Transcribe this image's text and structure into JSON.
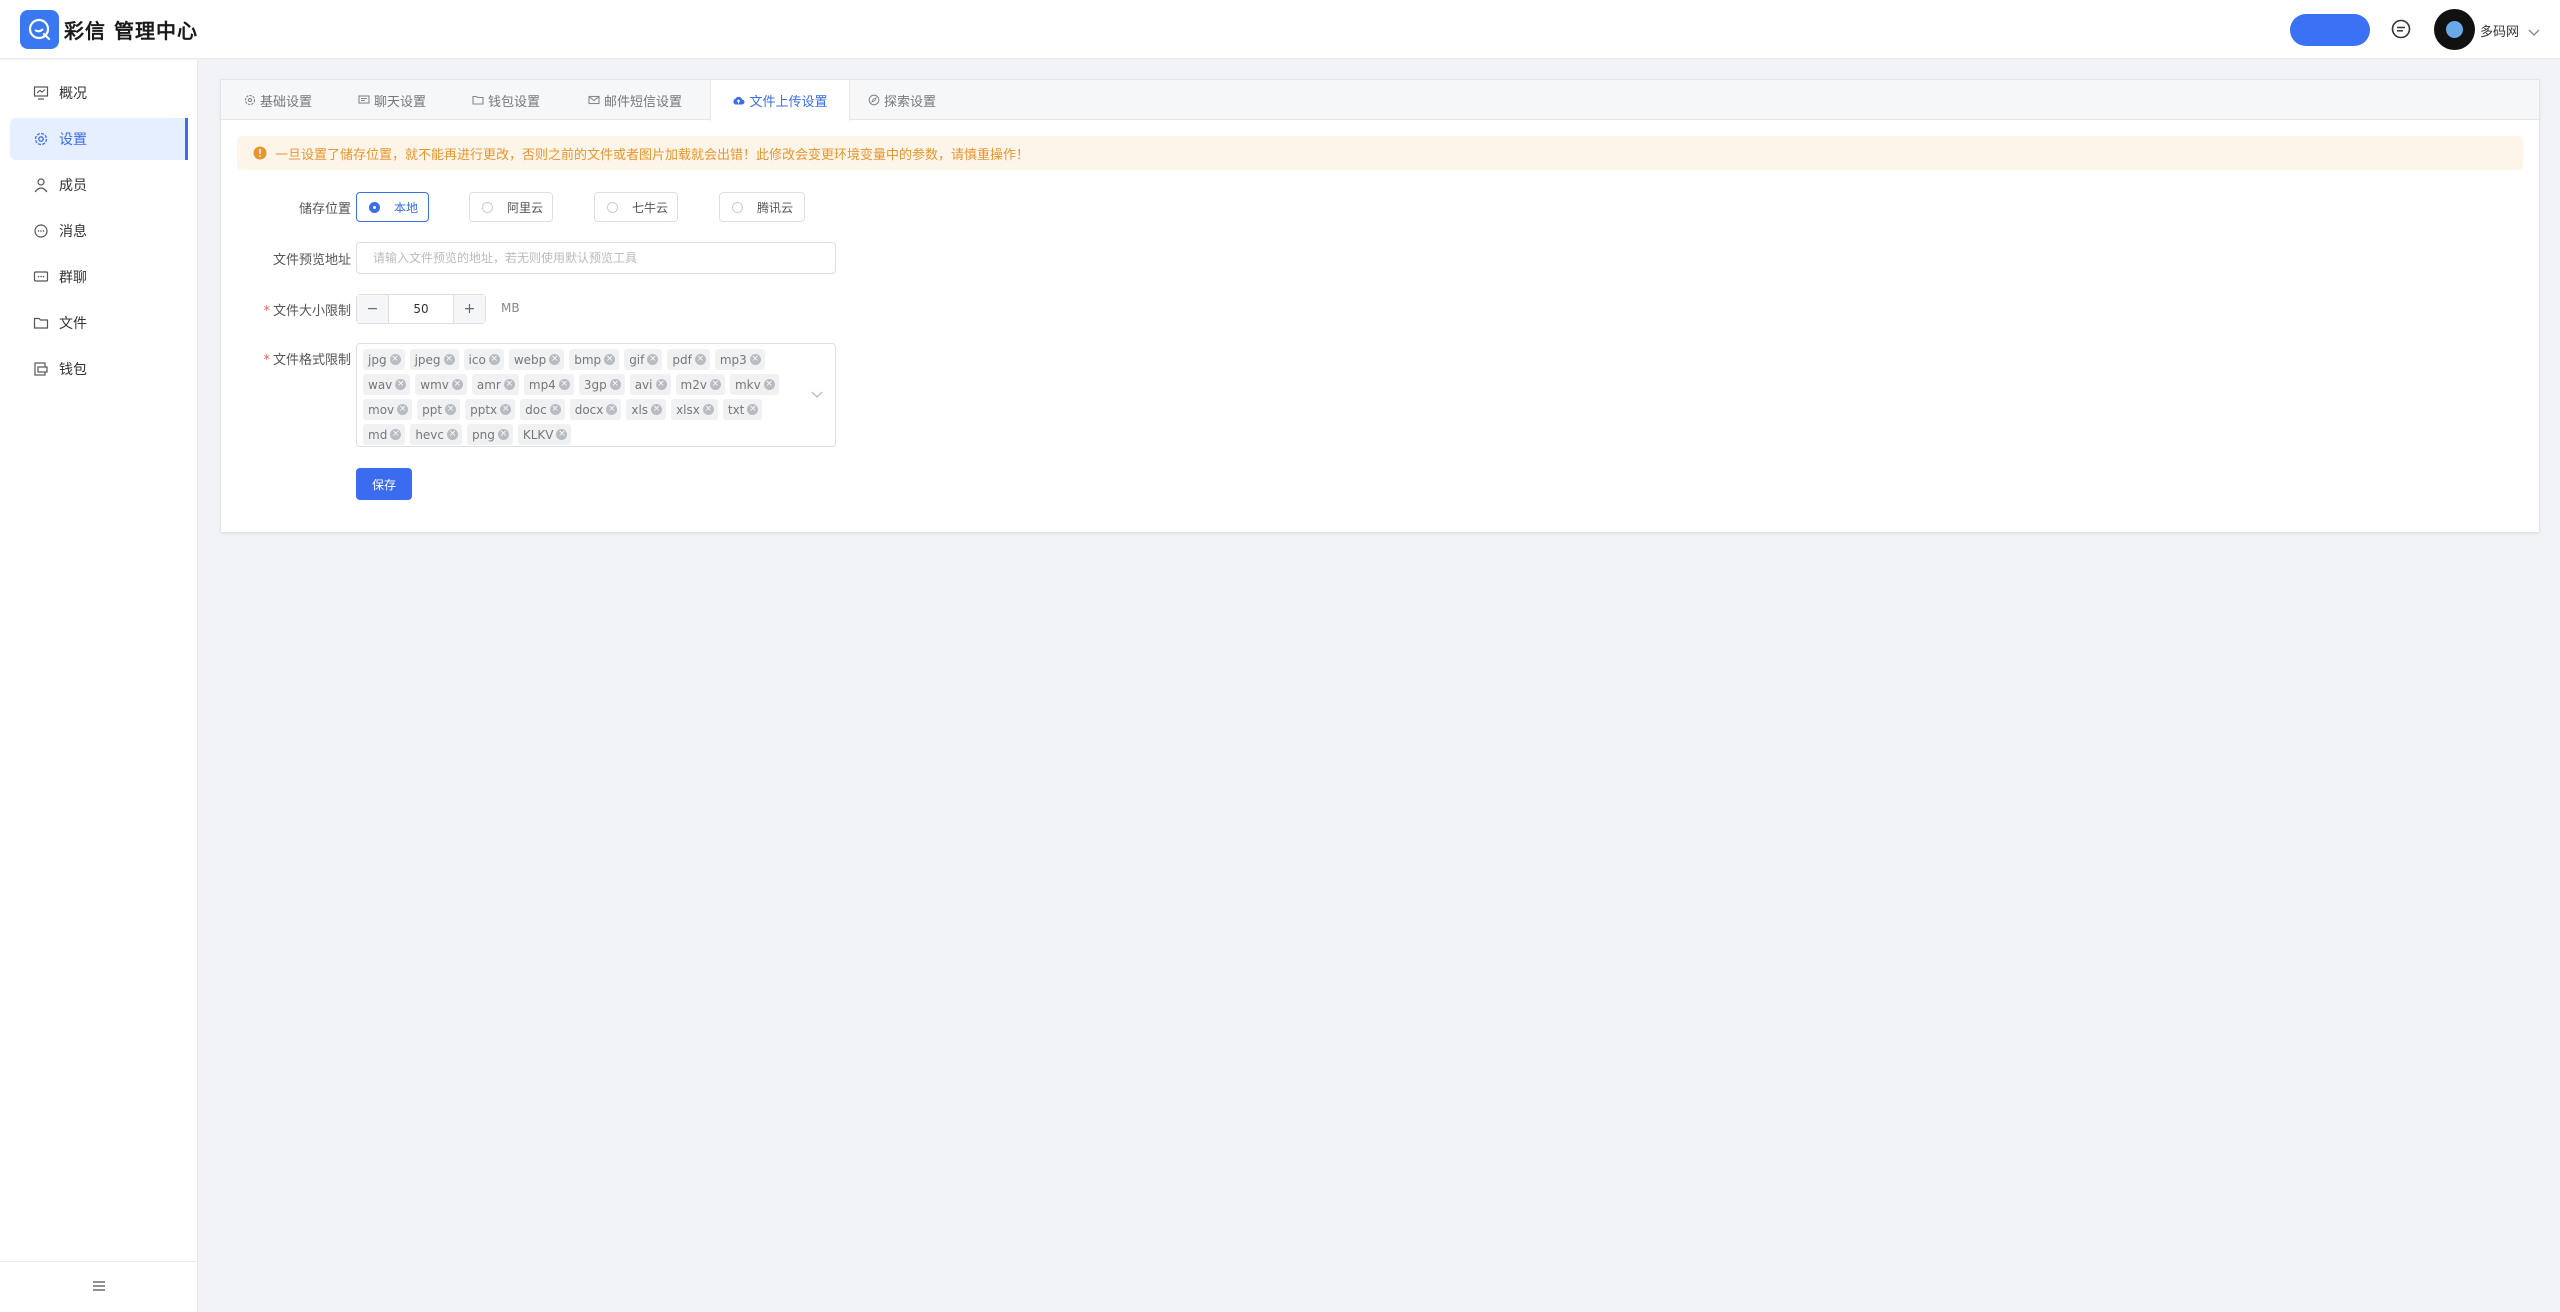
{
  "header": {
    "app_name": "彩信 管理中心",
    "username": "多码网"
  },
  "sidebar": {
    "items": [
      {
        "label": "概况",
        "icon": "dashboard-icon"
      },
      {
        "label": "设置",
        "icon": "gear-icon"
      },
      {
        "label": "成员",
        "icon": "user-icon"
      },
      {
        "label": "消息",
        "icon": "message-icon"
      },
      {
        "label": "群聊",
        "icon": "group-chat-icon"
      },
      {
        "label": "文件",
        "icon": "folder-icon"
      },
      {
        "label": "钱包",
        "icon": "wallet-icon"
      }
    ],
    "active_index": 1
  },
  "tabs": [
    {
      "label": "基础设置",
      "icon": "gear-icon"
    },
    {
      "label": "聊天设置",
      "icon": "chat-icon"
    },
    {
      "label": "钱包设置",
      "icon": "folder-icon"
    },
    {
      "label": "邮件短信设置",
      "icon": "mail-icon"
    },
    {
      "label": "文件上传设置",
      "icon": "cloud-upload-icon"
    },
    {
      "label": "探索设置",
      "icon": "compass-icon"
    }
  ],
  "active_tab": 4,
  "alert": {
    "text": "一旦设置了储存位置，就不能再进行更改，否则之前的文件或者图片加载就会出错！此修改会变更环境变量中的参数，请慎重操作！"
  },
  "form": {
    "storage_label": "储存位置",
    "storage_options": [
      "本地",
      "阿里云",
      "七牛云",
      "腾讯云"
    ],
    "storage_selected": "本地",
    "preview_label": "文件预览地址",
    "preview_value": "",
    "preview_placeholder": "请输入文件预览的地址，若无则使用默认预览工具",
    "size_label": "文件大小限制",
    "size_value": "50",
    "size_unit": "MB",
    "size_minus": "−",
    "size_plus": "+",
    "format_label": "文件格式限制",
    "formats": [
      "jpg",
      "jpeg",
      "ico",
      "webp",
      "bmp",
      "gif",
      "pdf",
      "mp3",
      "wav",
      "wmv",
      "amr",
      "mp4",
      "3gp",
      "avi",
      "m2v",
      "mkv",
      "mov",
      "ppt",
      "pptx",
      "doc",
      "docx",
      "xls",
      "xlsx",
      "txt",
      "md",
      "hevc",
      "png",
      "KLKV"
    ],
    "required_mark": "*",
    "save_label": "保存"
  },
  "colors": {
    "accent": "#3a6ee8",
    "alert_text": "#e6962e",
    "alert_bg": "#fdf5ea"
  }
}
